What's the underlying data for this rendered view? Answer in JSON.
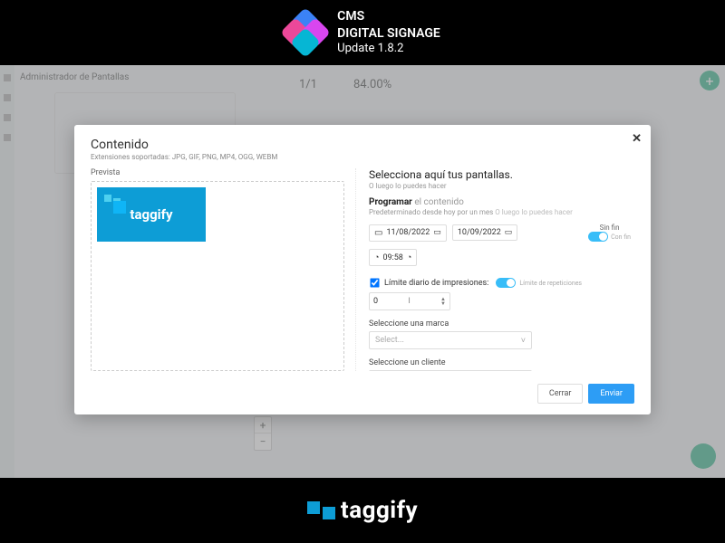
{
  "banner": {
    "line1": "CMS",
    "line2": "DIGITAL SIGNAGE",
    "line3": "Update 1.8.2"
  },
  "bg": {
    "header": "Administrador de Pantallas",
    "stat1": "1/1",
    "stat2": "84.00%"
  },
  "modal": {
    "title": "Contenido",
    "subtitle": "Extensiones soportadas: JPG, GIF, PNG, MP4, OGG, WEBM",
    "preview_label": "Prevista",
    "preview_brand": "taggify",
    "right": {
      "heading": "Selecciona aquí tus pantallas.",
      "hint1": "O luego lo puedes hacer",
      "program_label": "Programar",
      "program_gray": "el contenido",
      "program_hint": "Predeterminado desde hoy por un mes",
      "program_hint_small": "O luego lo puedes hacer",
      "date_from": "11/08/2022",
      "date_to": "10/09/2022",
      "endless_label": "Sin fin",
      "endless_sub": "Con fin",
      "time": "09:58",
      "limit_label": "Límite diario de impresiones:",
      "limit_sub": "Límite de repeticiones",
      "limit_value": "0",
      "brand_label": "Seleccione una marca",
      "client_label": "Seleccione un cliente",
      "select_placeholder": "Select..."
    },
    "footer": {
      "close": "Cerrar",
      "submit": "Enviar"
    }
  },
  "bottom": {
    "brand": "taggify"
  }
}
